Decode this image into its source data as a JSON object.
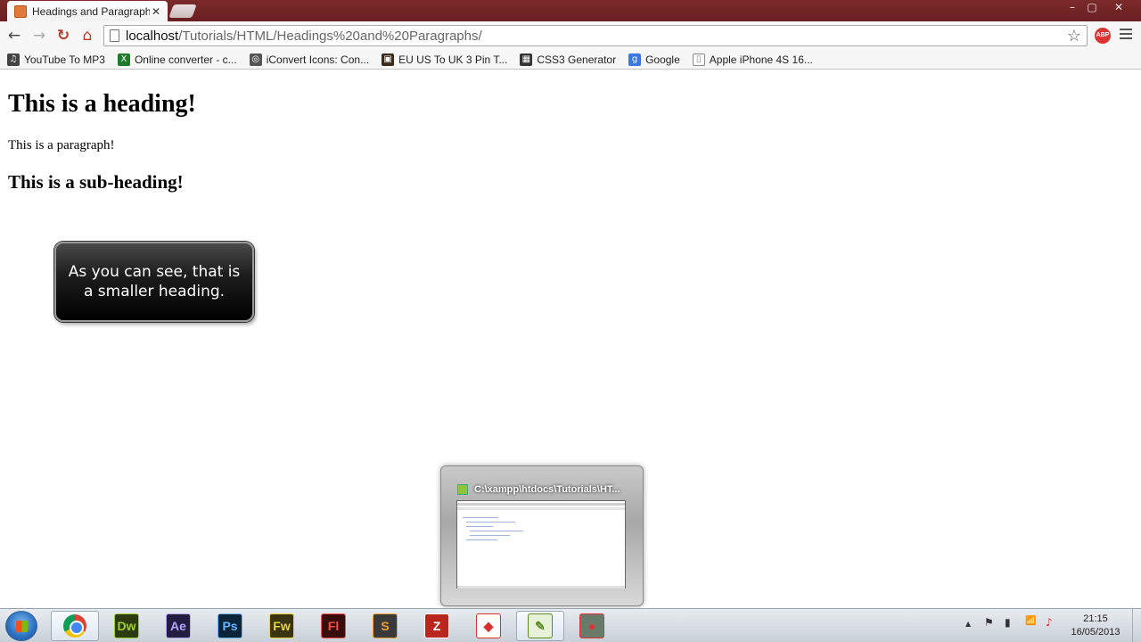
{
  "browser": {
    "tab_title": "Headings and Paragraphs",
    "tab_close": "✕",
    "url_host": "localhost",
    "url_path": "/Tutorials/HTML/Headings%20and%20Paragraphs/",
    "window_controls": {
      "minimize": "–",
      "maximize": "▢",
      "close": "✕"
    },
    "nav_icons": {
      "back": "←",
      "forward": "→",
      "reload": "↻",
      "home": "⌂",
      "star": "☆"
    },
    "ext_badge": "ABP"
  },
  "bookmarks": [
    {
      "label": "YouTube To MP3",
      "icon": "music-note-icon",
      "glyph": "♫",
      "color": "#444444"
    },
    {
      "label": "Online converter - c...",
      "icon": "converter-icon",
      "glyph": "X",
      "color": "#1f7a2a"
    },
    {
      "label": "iConvert Icons: Con...",
      "icon": "iconvert-icon",
      "glyph": "◎",
      "color": "#555555"
    },
    {
      "label": "EU US To UK 3 Pin T...",
      "icon": "shop-icon",
      "glyph": "▣",
      "color": "#3a2a1a"
    },
    {
      "label": "CSS3 Generator",
      "icon": "css3-icon",
      "glyph": "▦",
      "color": "#333333"
    },
    {
      "label": "Google",
      "icon": "google-icon",
      "glyph": "g",
      "color": "#3b78e7"
    },
    {
      "label": "Apple iPhone 4S 16...",
      "icon": "page-icon",
      "glyph": "▯",
      "color": "#ffffff"
    }
  ],
  "page": {
    "heading": "This is a heading!",
    "paragraph": "This is a paragraph!",
    "subheading": "This is a sub-heading!",
    "callout": "As you can see, that is a smaller heading."
  },
  "thumbnail": {
    "title": "C:\\xampp\\htdocs\\Tutorials\\HT..."
  },
  "taskbar": {
    "apps": [
      {
        "name": "chrome",
        "label": ""
      },
      {
        "name": "dreamweaver",
        "label": "Dw",
        "bg": "#2c3a10",
        "fg": "#9ccf2f"
      },
      {
        "name": "after-effects",
        "label": "Ae",
        "bg": "#231d3f",
        "fg": "#b3a5ff"
      },
      {
        "name": "photoshop",
        "label": "Ps",
        "bg": "#0d2438",
        "fg": "#5fb6ff"
      },
      {
        "name": "fireworks",
        "label": "Fw",
        "bg": "#3a3410",
        "fg": "#e6d33a"
      },
      {
        "name": "flash",
        "label": "Fl",
        "bg": "#3a0d0d",
        "fg": "#ff4a4a"
      },
      {
        "name": "sublime",
        "label": "S",
        "bg": "#3a3a3a",
        "fg": "#f0a030"
      },
      {
        "name": "filezilla",
        "label": "Z",
        "bg": "#b8261e",
        "fg": "#ffffff"
      },
      {
        "name": "sketchup",
        "label": "◆",
        "bg": "#ffffff",
        "fg": "#d8302a"
      },
      {
        "name": "notepad-plus",
        "label": "✎",
        "bg": "#e8f2d8",
        "fg": "#5a8a20"
      },
      {
        "name": "video-tool",
        "label": "●",
        "bg": "#6a7a6a",
        "fg": "#d33"
      }
    ],
    "tray_icons": {
      "up_arrow": "▲",
      "flag": "⚑",
      "network": "▮",
      "signal": "📶",
      "volume": "♪"
    },
    "time": "21:15",
    "date": "16/05/2013"
  }
}
